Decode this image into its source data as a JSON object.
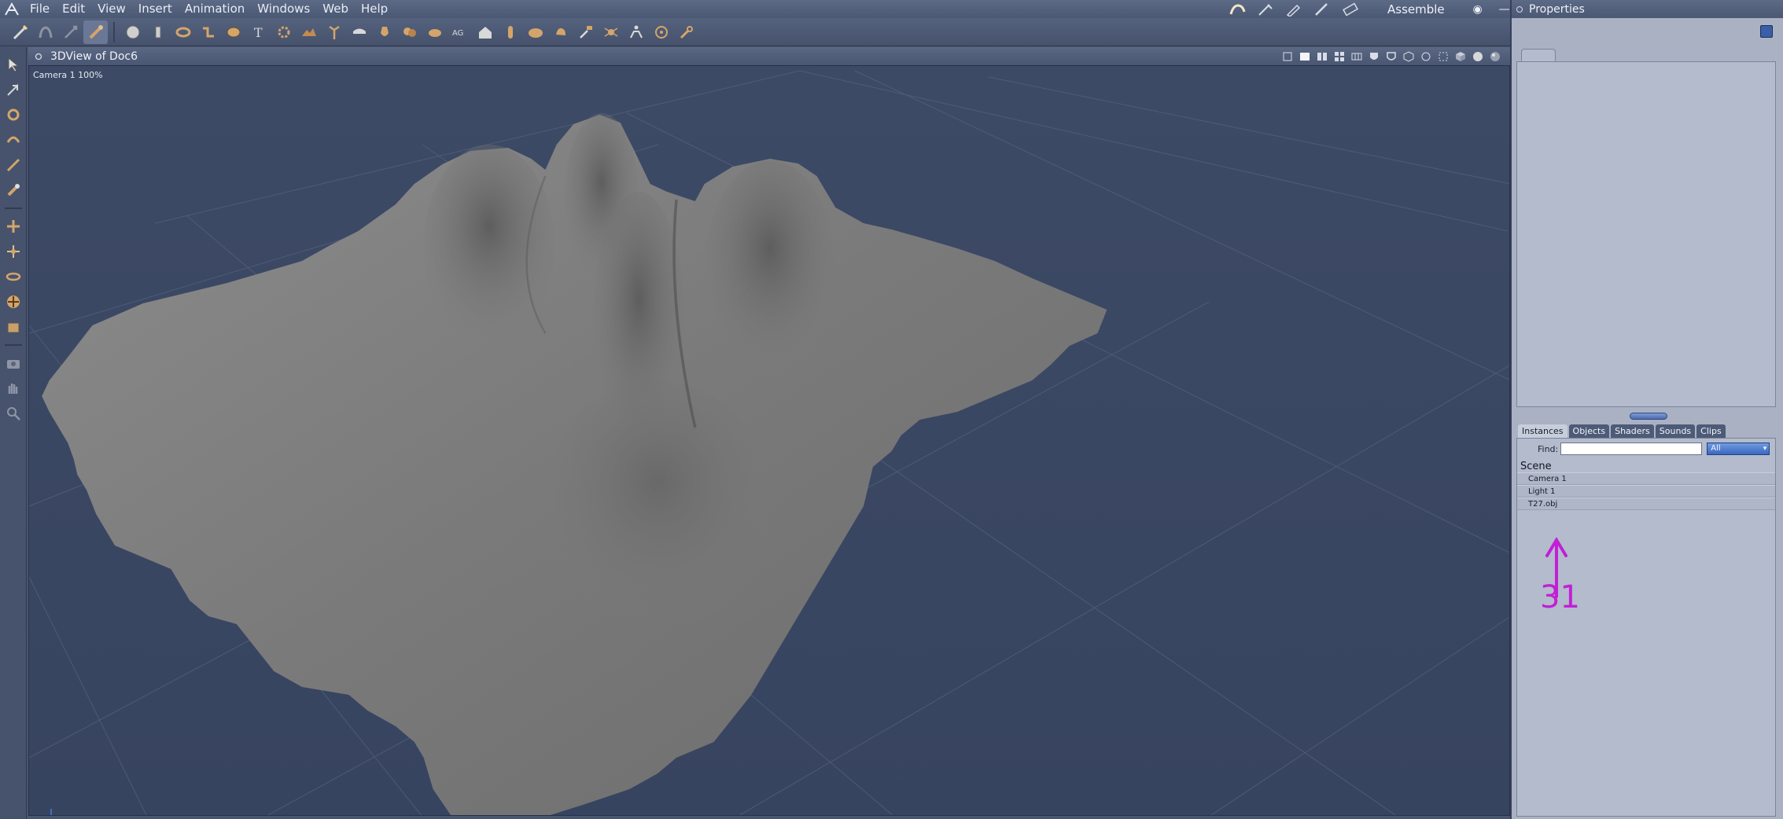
{
  "menubar": {
    "items": [
      "File",
      "Edit",
      "View",
      "Insert",
      "Animation",
      "Windows",
      "Web",
      "Help"
    ],
    "mode_label": "Assemble"
  },
  "view": {
    "title": "3DView of Doc6",
    "camera_label": "Camera 1 100%"
  },
  "properties": {
    "title": "Properties"
  },
  "browser": {
    "tabs": [
      "Instances",
      "Objects",
      "Shaders",
      "Sounds",
      "Clips"
    ],
    "active_tab": "Instances",
    "find_label": "Find:",
    "find_value": "",
    "filter_value": "All",
    "tree_root": "Scene",
    "tree_items": [
      "Camera 1",
      "Light 1",
      "T27.obj"
    ]
  },
  "annotation": {
    "text": "31",
    "color": "#c21fd6"
  },
  "colors": {
    "viewport_bg": "#3a4762",
    "terrain": "#7d7d7d",
    "accent_blue": "#3b67c0"
  }
}
